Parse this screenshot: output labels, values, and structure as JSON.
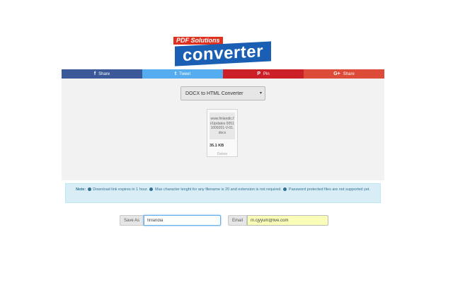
{
  "logo": {
    "badge": "PDF Solutions",
    "word": "converter"
  },
  "share": [
    {
      "label": "Share",
      "icon": "f",
      "icon_name": "facebook-icon",
      "color": "#3b5998"
    },
    {
      "label": "Tweet",
      "icon": "t",
      "icon_name": "twitter-icon",
      "color": "#55acee"
    },
    {
      "label": "Pin",
      "icon": "P",
      "icon_name": "pinterest-icon",
      "color": "#cb2027"
    },
    {
      "label": "Share",
      "icon": "G+",
      "icon_name": "google-plus-icon",
      "color": "#dd4b39"
    }
  ],
  "converter": {
    "selected": "DOCX to HTML Converter"
  },
  "file": {
    "name": "www.finlandic.fi/Updates 00511009201-V-01.docx",
    "size": "35.1 KB",
    "delete": "Delete"
  },
  "note": {
    "prefix": "Note:",
    "items": [
      "Download link expires in 1 hour.",
      "Max character lenght for any filename is 20 and extension is not required.",
      "Password protected files are not supported yet."
    ]
  },
  "form": {
    "save_as_label": "Save As",
    "save_as_value": "finlandia",
    "email_label": "Email",
    "email_value": "m.cjyyum@live.com"
  }
}
